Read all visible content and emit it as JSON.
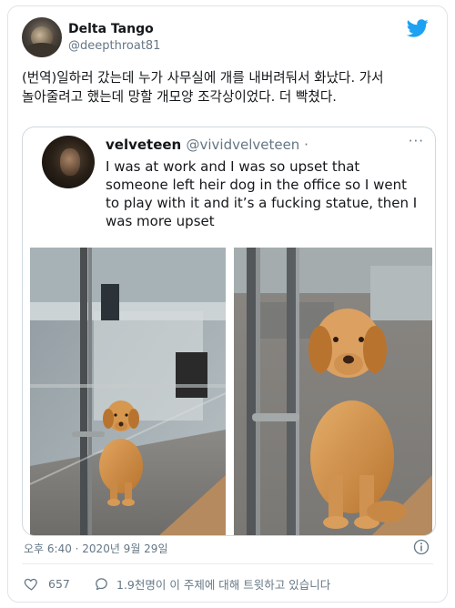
{
  "tweet": {
    "display_name": "Delta Tango",
    "handle": "@deepthroat81",
    "text": "(번역)일하러 갔는데 누가 사무실에 개를 내버려둬서 화났다. 가서 놀아줄려고 했는데 망할 개모양 조각상이었다. 더 빡쳤다.",
    "timestamp": "오후 6:40 · 2020년 9월 29일",
    "likes": "657",
    "conversation": "1.9천명이 이 주제에 대해 트윗하고 있습니다"
  },
  "quote": {
    "display_name": "velveteen",
    "handle": "@vividvelveteen ·",
    "more": "···",
    "text": "I was at work and I was so upset that someone left heir dog in the office so I went to play with it and it’s a fucking statue, then I was more upset"
  },
  "icons": {
    "brand": "twitter-bird-icon",
    "info": "info-icon",
    "like": "heart-icon",
    "reply": "speech-bubble-icon"
  },
  "colors": {
    "twitter_blue": "#1da1f2",
    "secondary_text": "#657786",
    "border": "#cfd9de"
  }
}
